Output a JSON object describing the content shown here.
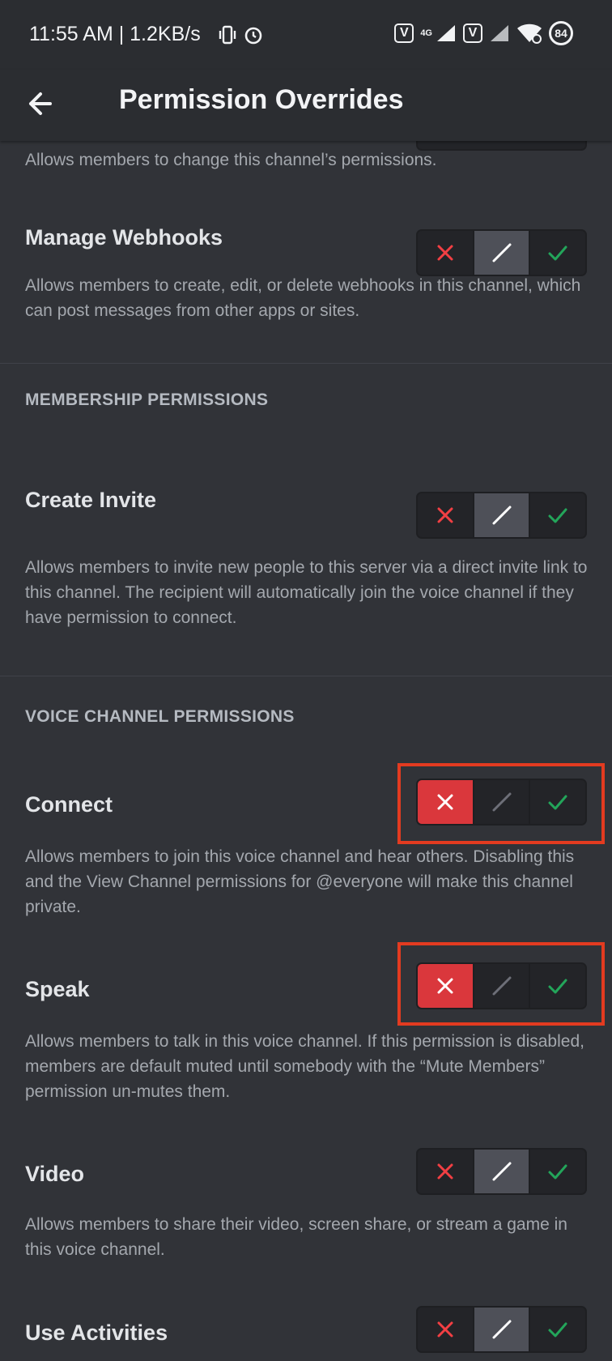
{
  "status_bar": {
    "time": "11:55 AM | 1.2KB/s",
    "network": "4G",
    "battery": "84"
  },
  "app_bar": {
    "title": "Permission Overrides"
  },
  "top_description": "Allows members to change this channel’s permissions.",
  "items": [
    {
      "id": "manage-webhooks",
      "name": "Manage Webhooks",
      "description": "Allows members to create, edit, or delete webhooks in this channel, which can post messages from other apps or sites.",
      "state": "neutral"
    },
    {
      "id": "create-invite",
      "name": "Create Invite",
      "description": "Allows members to invite new people to this server via a direct invite link to this channel. The recipient will automatically join the voice channel if they have permission to connect.",
      "state": "neutral"
    },
    {
      "id": "connect",
      "name": "Connect",
      "description": "Allows members to join this voice channel and hear others. Disabling this and the View Channel permissions for @everyone will make this channel private.",
      "state": "deny"
    },
    {
      "id": "speak",
      "name": "Speak",
      "description": "Allows members to talk in this voice channel. If this permission is disabled, members are default muted until somebody with the “Mute Members” permission un-mutes them.",
      "state": "deny"
    },
    {
      "id": "video",
      "name": "Video",
      "description": "Allows members to share their video, screen share, or stream a game in this voice channel.",
      "state": "neutral"
    },
    {
      "id": "use-activities",
      "name": "Use Activities",
      "description": "",
      "state": "neutral"
    }
  ],
  "sections": {
    "membership": "MEMBERSHIP PERMISSIONS",
    "voice": "VOICE CHANNEL PERMISSIONS"
  },
  "colors": {
    "deny": "#da373c",
    "allow": "#23a55a",
    "deny_icon": "#f23f43",
    "highlight": "#e33b20"
  }
}
